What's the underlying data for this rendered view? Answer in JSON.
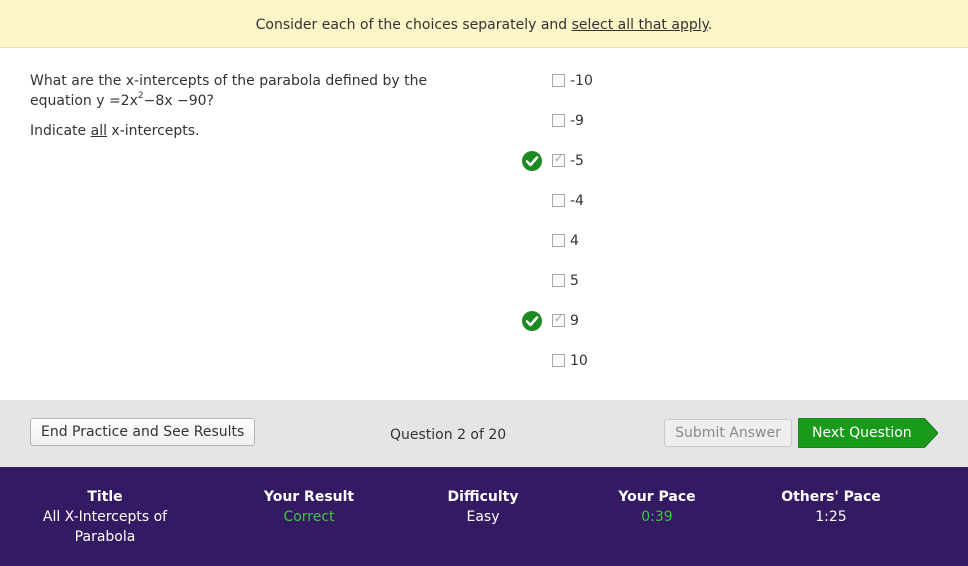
{
  "banner": {
    "text_before": "Consider each of the choices separately and ",
    "link": "select all that apply",
    "text_after": "."
  },
  "question": {
    "line_pre": "What are the x-intercepts of the parabola defined by the equation y =2x",
    "exponent": "2",
    "line_post": "−8x −90?",
    "indicate_pre": "Indicate ",
    "indicate_em": "all",
    "indicate_post": " x-intercepts."
  },
  "choices": [
    {
      "label": "-10",
      "checked": false,
      "correct_mark": false
    },
    {
      "label": "-9",
      "checked": false,
      "correct_mark": false
    },
    {
      "label": "-5",
      "checked": true,
      "correct_mark": true
    },
    {
      "label": "-4",
      "checked": false,
      "correct_mark": false
    },
    {
      "label": "4",
      "checked": false,
      "correct_mark": false
    },
    {
      "label": "5",
      "checked": false,
      "correct_mark": false
    },
    {
      "label": "9",
      "checked": true,
      "correct_mark": true
    },
    {
      "label": "10",
      "checked": false,
      "correct_mark": false
    }
  ],
  "controls": {
    "end_button": "End Practice and See Results",
    "question_count": "Question 2 of 20",
    "submit_button": "Submit Answer",
    "next_button": "Next Question"
  },
  "footer": {
    "title_label": "Title",
    "title_value": "All X-Intercepts of Parabola",
    "result_label": "Your Result",
    "result_value": "Correct",
    "difficulty_label": "Difficulty",
    "difficulty_value": "Easy",
    "pace_label": "Your Pace",
    "pace_value": "0:39",
    "others_label": "Others' Pace",
    "others_value": "1:25"
  },
  "colors": {
    "banner_bg": "#fcf5c7",
    "correct_green": "#1a8a21",
    "next_button_green": "#1a9a1a",
    "footer_bg": "#341a63",
    "result_green": "#3cc83c"
  },
  "icons": {
    "correct_mark": "check-circle-icon",
    "next_arrow": "arrow-right-shape"
  }
}
